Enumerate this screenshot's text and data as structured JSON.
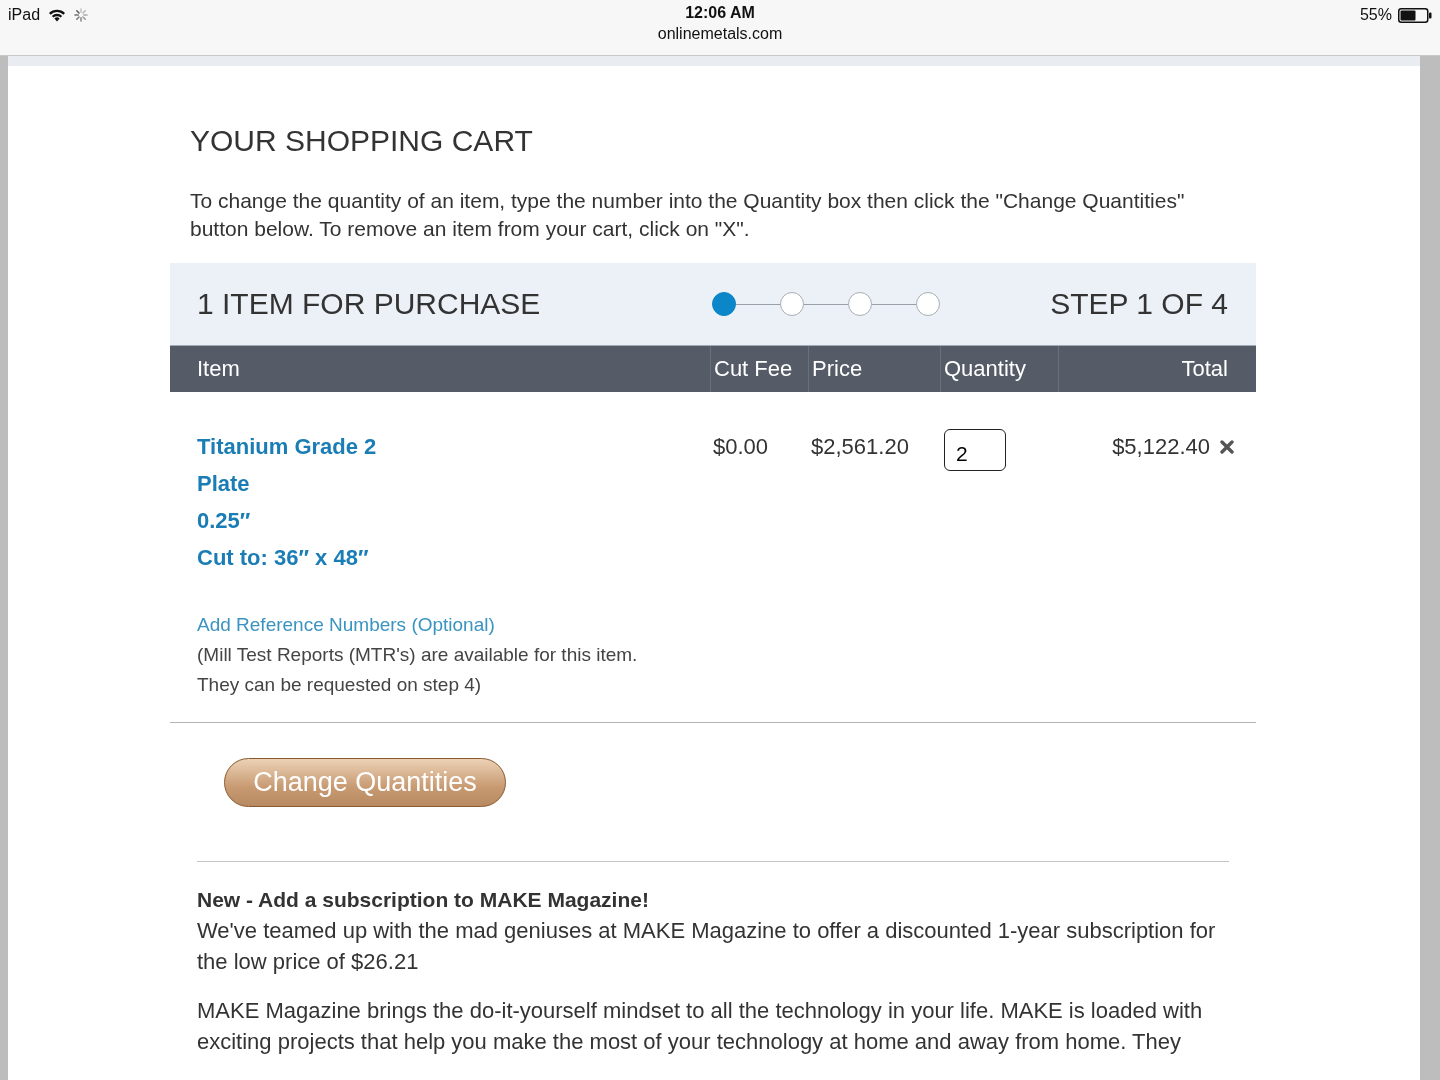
{
  "status_bar": {
    "device": "iPad",
    "time": "12:06 AM",
    "url": "onlinemetals.com",
    "battery": "55%"
  },
  "page": {
    "title": "YOUR SHOPPING CART",
    "instructions": "To change the quantity of an item, type the number into the Quantity box then click the \"Change Quantities\" button below. To remove an item from your cart, click on \"X\"."
  },
  "cart": {
    "heading": "1 ITEM FOR PURCHASE",
    "steps": [
      {
        "selected": true
      },
      {
        "selected": false
      },
      {
        "selected": false
      },
      {
        "selected": false
      }
    ],
    "step_label": "STEP 1 OF 4",
    "columns": [
      "Item",
      "Cut Fee",
      "Price",
      "Quantity",
      "Total"
    ],
    "rows": [
      {
        "item_lines": [
          "Titanium Grade 2",
          "Plate",
          "0.25″",
          "Cut to: 36″ x 48″"
        ],
        "cut_fee": "$0.00",
        "price": "$2,561.20",
        "quantity": "2",
        "total": "$5,122.40"
      }
    ],
    "reference_link": "Add Reference Numbers (Optional)",
    "mtr_note": "(Mill Test Reports (MTR's) are available for this item.\nThey can be requested on step 4)"
  },
  "change_button": "Change Quantities",
  "promo": {
    "heading": "New - Add a subscription to MAKE Magazine!",
    "text": "We've teamed up with the mad geniuses at MAKE Magazine to offer a discounted 1-year subscription for the low price of $26.21",
    "body": "MAKE Magazine brings the do-it-yourself mindset to all the technology in your life. MAKE is loaded with exciting projects that help you make the most of your technology at home and away from home. They"
  }
}
